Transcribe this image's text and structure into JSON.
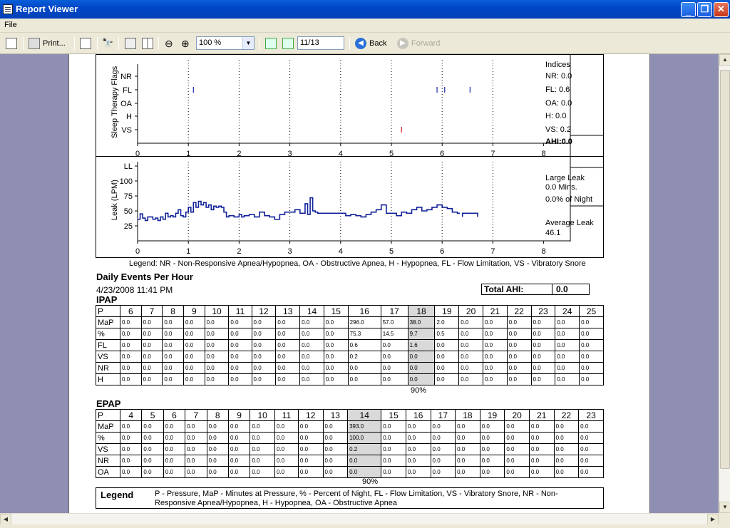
{
  "window": {
    "title": "Report Viewer"
  },
  "menu": {
    "items": [
      "File"
    ]
  },
  "toolbar": {
    "print_label": "Print...",
    "zoom_value": "100 %",
    "page_value": "11/13",
    "back_label": "Back",
    "forward_label": "Forward"
  },
  "report": {
    "flags_chart": {
      "ylabel": "Sleep Therapy Flags",
      "rows": [
        "NR",
        "FL",
        "OA",
        "H",
        "VS"
      ],
      "xticks": [
        "0",
        "1",
        "2",
        "3",
        "4",
        "5",
        "6",
        "7",
        "8"
      ],
      "indices_title": "Indices",
      "indices": [
        "NR: 0.0",
        "FL: 0.6",
        "OA: 0.0",
        "H: 0.0",
        "VS: 0.2"
      ],
      "ahi": "AHI:0.0"
    },
    "leak_chart": {
      "ylabel": "Leak (LPM)",
      "yticks": [
        "LL",
        "100",
        "75",
        "50",
        "25"
      ],
      "xticks": [
        "0",
        "1",
        "2",
        "3",
        "4",
        "5",
        "6",
        "7",
        "8"
      ],
      "large_leak_title": "Large Leak",
      "large_leak_mins": "0.0 Mins.",
      "large_leak_pct": "0.0% of Night",
      "avg_leak_title": "Average Leak",
      "avg_leak_value": "46.1"
    },
    "chart_legend": "Legend: NR - Non-Responsive Apnea/Hypopnea, OA - Obstructive Apnea, H - Hypopnea, FL - Flow Limitation, VS - Vibratory Snore",
    "daily_title": "Daily Events Per Hour",
    "date": "4/23/2008 11:41 PM",
    "total_ahi_label": "Total AHI:",
    "total_ahi_value": "0.0",
    "ipap": {
      "title": "IPAP",
      "header": [
        "P",
        "6",
        "7",
        "8",
        "9",
        "10",
        "11",
        "12",
        "13",
        "14",
        "15",
        "16",
        "17",
        "18",
        "19",
        "20",
        "21",
        "22",
        "23",
        "24",
        "25"
      ],
      "rows": [
        [
          "MaP",
          "0.0",
          "0.0",
          "0.0",
          "0.0",
          "0.0",
          "0.0",
          "0.0",
          "0.0",
          "0.0",
          "0.0",
          "296.0",
          "57.0",
          "38.0",
          "2.0",
          "0.0",
          "0.0",
          "0.0",
          "0.0",
          "0.0",
          "0.0"
        ],
        [
          "%",
          "0.0",
          "0.0",
          "0.0",
          "0.0",
          "0.0",
          "0.0",
          "0.0",
          "0.0",
          "0.0",
          "0.0",
          "75.3",
          "14.5",
          "9.7",
          "0.5",
          "0.0",
          "0.0",
          "0.0",
          "0.0",
          "0.0",
          "0.0"
        ],
        [
          "FL",
          "0.0",
          "0.0",
          "0.0",
          "0.0",
          "0.0",
          "0.0",
          "0.0",
          "0.0",
          "0.0",
          "0.0",
          "0.6",
          "0.0",
          "1.6",
          "0.0",
          "0.0",
          "0.0",
          "0.0",
          "0.0",
          "0.0",
          "0.0"
        ],
        [
          "VS",
          "0.0",
          "0.0",
          "0.0",
          "0.0",
          "0.0",
          "0.0",
          "0.0",
          "0.0",
          "0.0",
          "0.0",
          "0.2",
          "0.0",
          "0.0",
          "0.0",
          "0.0",
          "0.0",
          "0.0",
          "0.0",
          "0.0",
          "0.0"
        ],
        [
          "NR",
          "0.0",
          "0.0",
          "0.0",
          "0.0",
          "0.0",
          "0.0",
          "0.0",
          "0.0",
          "0.0",
          "0.0",
          "0.0",
          "0.0",
          "0.0",
          "0.0",
          "0.0",
          "0.0",
          "0.0",
          "0.0",
          "0.0",
          "0.0"
        ],
        [
          "H",
          "0.0",
          "0.0",
          "0.0",
          "0.0",
          "0.0",
          "0.0",
          "0.0",
          "0.0",
          "0.0",
          "0.0",
          "0.0",
          "0.0",
          "0.0",
          "0.0",
          "0.0",
          "0.0",
          "0.0",
          "0.0",
          "0.0",
          "0.0"
        ]
      ],
      "highlight_col": 13,
      "pct_label": "90%"
    },
    "epap": {
      "title": "EPAP",
      "header": [
        "P",
        "4",
        "5",
        "6",
        "7",
        "8",
        "9",
        "10",
        "11",
        "12",
        "13",
        "14",
        "15",
        "16",
        "17",
        "18",
        "19",
        "20",
        "21",
        "22",
        "23"
      ],
      "rows": [
        [
          "MaP",
          "0.0",
          "0.0",
          "0.0",
          "0.0",
          "0.0",
          "0.0",
          "0.0",
          "0.0",
          "0.0",
          "0.0",
          "393.0",
          "0.0",
          "0.0",
          "0.0",
          "0.0",
          "0.0",
          "0.0",
          "0.0",
          "0.0",
          "0.0"
        ],
        [
          "%",
          "0.0",
          "0.0",
          "0.0",
          "0.0",
          "0.0",
          "0.0",
          "0.0",
          "0.0",
          "0.0",
          "0.0",
          "100.0",
          "0.0",
          "0.0",
          "0.0",
          "0.0",
          "0.0",
          "0.0",
          "0.0",
          "0.0",
          "0.0"
        ],
        [
          "VS",
          "0.0",
          "0.0",
          "0.0",
          "0.0",
          "0.0",
          "0.0",
          "0.0",
          "0.0",
          "0.0",
          "0.0",
          "0.2",
          "0.0",
          "0.0",
          "0.0",
          "0.0",
          "0.0",
          "0.0",
          "0.0",
          "0.0",
          "0.0"
        ],
        [
          "NR",
          "0.0",
          "0.0",
          "0.0",
          "0.0",
          "0.0",
          "0.0",
          "0.0",
          "0.0",
          "0.0",
          "0.0",
          "0.0",
          "0.0",
          "0.0",
          "0.0",
          "0.0",
          "0.0",
          "0.0",
          "0.0",
          "0.0",
          "0.0"
        ],
        [
          "OA",
          "0.0",
          "0.0",
          "0.0",
          "0.0",
          "0.0",
          "0.0",
          "0.0",
          "0.0",
          "0.0",
          "0.0",
          "0.0",
          "0.0",
          "0.0",
          "0.0",
          "0.0",
          "0.0",
          "0.0",
          "0.0",
          "0.0",
          "0.0"
        ]
      ],
      "highlight_col": 11,
      "pct_label": "90%"
    },
    "legend_title": "Legend",
    "legend_text": "P - Pressure, MaP - Minutes at Pressure, % - Percent of Night, FL - Flow Limitation, VS - Vibratory Snore, NR - Non-Responsive Apnea/Hypopnea, H - Hypopnea, OA - Obstructive Apnea"
  },
  "chart_data": [
    {
      "type": "scatter",
      "ylabel": "Sleep Therapy Flags",
      "xlim": [
        0,
        8
      ],
      "categories": [
        "NR",
        "FL",
        "OA",
        "H",
        "VS"
      ],
      "series": [
        {
          "name": "FL",
          "x": [
            1.1,
            5.9,
            6.05,
            6.55
          ],
          "color": "#1a2aa8"
        },
        {
          "name": "VS",
          "x": [
            5.2
          ],
          "color": "#d02020"
        }
      ]
    },
    {
      "type": "line",
      "ylabel": "Leak (LPM)",
      "xlim": [
        0,
        8
      ],
      "ylim": [
        0,
        125
      ],
      "series": [
        {
          "color": "#10209a",
          "x": [
            0.0,
            0.05,
            0.1,
            0.15,
            0.2,
            0.3,
            0.35,
            0.4,
            0.45,
            0.5,
            0.55,
            0.6,
            0.65,
            0.7,
            0.75,
            0.8,
            0.85,
            0.9,
            0.95,
            1.0,
            1.05,
            1.1,
            1.15,
            1.2,
            1.25,
            1.3,
            1.35,
            1.4,
            1.45,
            1.5,
            1.55,
            1.6,
            1.65,
            1.7,
            1.75,
            1.8,
            1.9,
            2.0,
            2.05,
            2.1,
            2.2,
            2.3,
            2.4,
            2.5,
            2.6,
            2.7,
            2.8,
            2.9,
            3.0,
            3.1,
            3.2,
            3.3,
            3.35,
            3.4,
            3.45,
            3.5,
            3.55,
            3.6,
            3.7,
            3.8,
            3.9,
            4.0,
            4.1,
            4.2,
            4.3,
            4.4,
            4.5,
            4.6,
            4.7,
            4.8,
            4.9,
            5.0,
            5.1,
            5.2,
            5.3,
            5.4,
            5.5,
            5.6,
            5.7,
            5.8,
            5.9,
            6.0,
            6.1,
            6.2,
            6.3
          ],
          "y": [
            36,
            45,
            38,
            34,
            40,
            36,
            38,
            34,
            40,
            36,
            46,
            40,
            42,
            40,
            46,
            52,
            42,
            40,
            48,
            56,
            48,
            64,
            56,
            66,
            60,
            64,
            56,
            60,
            52,
            58,
            56,
            58,
            56,
            48,
            40,
            42,
            40,
            44,
            40,
            42,
            44,
            40,
            48,
            42,
            40,
            36,
            44,
            48,
            48,
            52,
            46,
            62,
            44,
            72,
            50,
            48,
            46,
            46,
            46,
            46,
            46,
            46,
            42,
            44,
            42,
            40,
            44,
            48,
            52,
            60,
            46,
            46,
            42,
            48,
            46,
            52,
            56,
            50,
            52,
            56,
            60,
            56,
            54,
            48,
            46
          ]
        }
      ]
    }
  ]
}
